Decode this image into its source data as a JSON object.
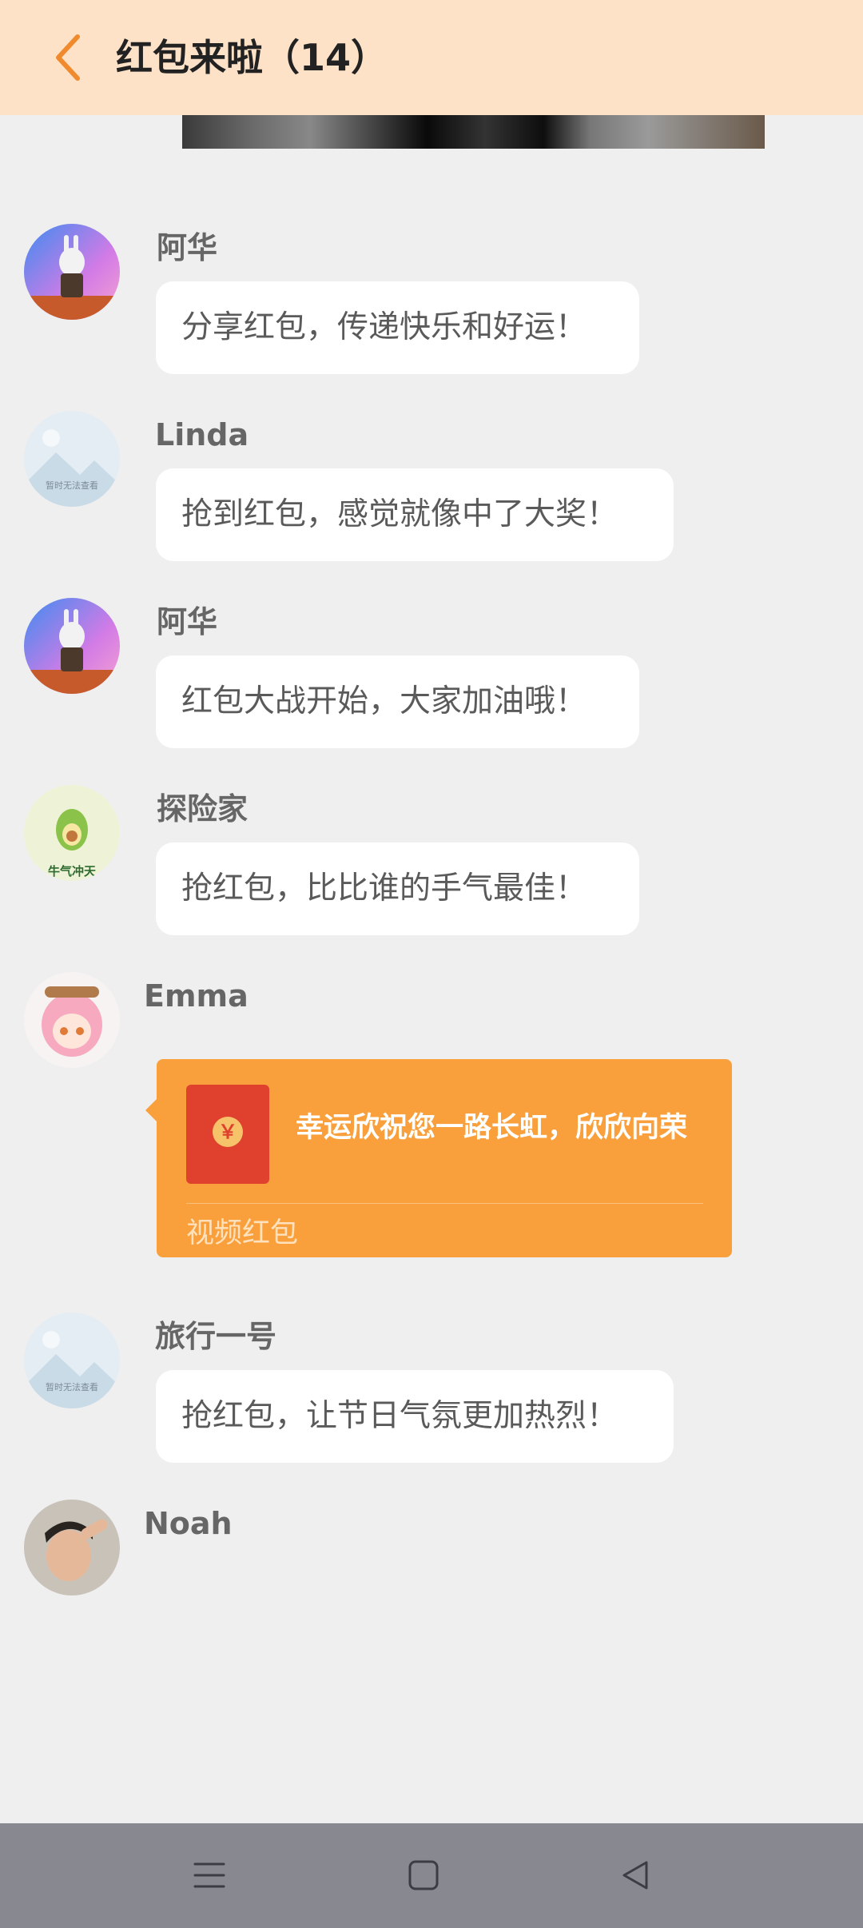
{
  "header": {
    "title": "红包来啦（14）"
  },
  "messages": [
    {
      "sender": "阿华",
      "text": "分享红包，传递快乐和好运！"
    },
    {
      "sender": "Linda",
      "text": "抢到红包，感觉就像中了大奖！"
    },
    {
      "sender": "阿华",
      "text": "红包大战开始，大家加油哦！"
    },
    {
      "sender": "探险家",
      "text": "抢红包，比比谁的手气最佳！"
    },
    {
      "sender": "Emma"
    },
    {
      "sender": "旅行一号",
      "text": "抢红包，让节日气氛更加热烈！"
    },
    {
      "sender": "Noah"
    }
  ],
  "red_packet": {
    "greeting": "幸运欣祝您一路长虹，欣欣向荣",
    "type_label": "视频红包",
    "coin_symbol": "￥"
  },
  "avatar_placeholder_text": "暂时无法查看",
  "avatar_badge_text": "牛气冲天",
  "colors": {
    "header_bg": "#fde2c8",
    "accent": "#f08a2c",
    "red_packet": "#f9a03c",
    "page_bg": "#efeff0"
  }
}
